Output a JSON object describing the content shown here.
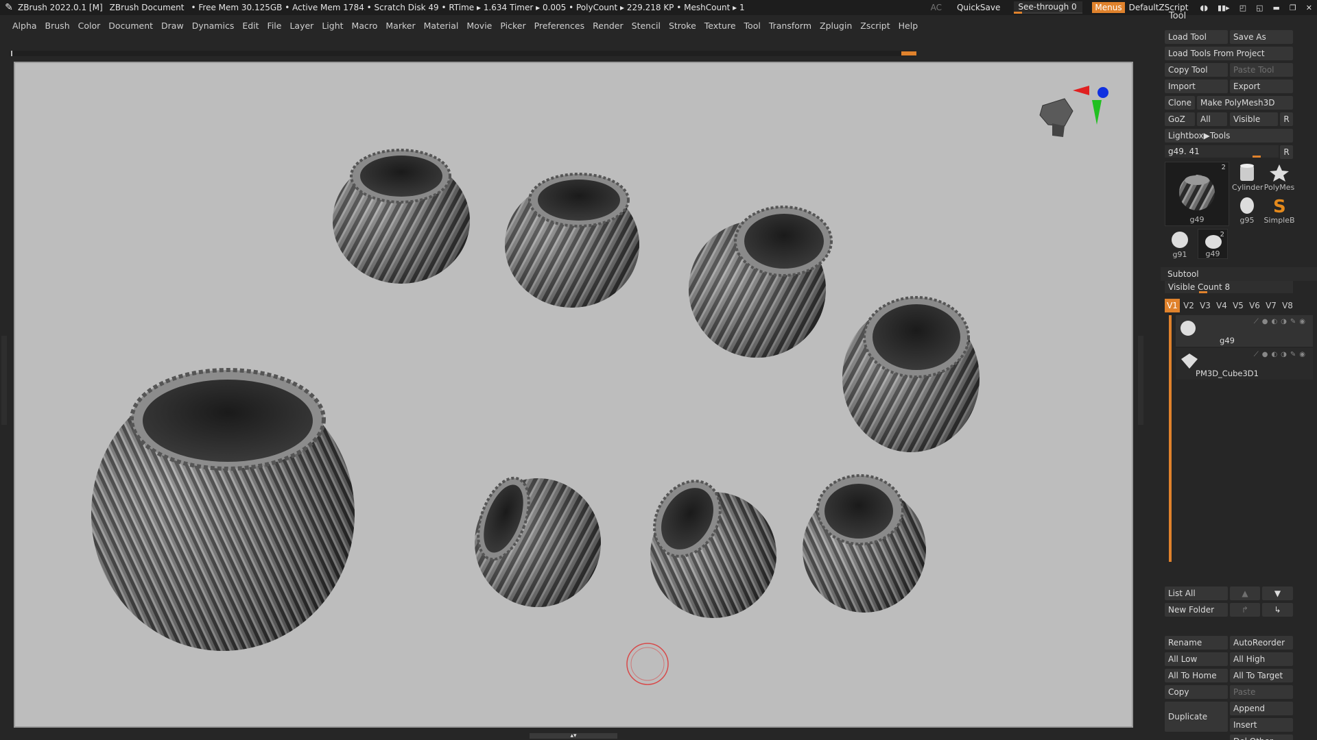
{
  "titlebar": {
    "app_title": "ZBrush 2022.0.1 [M]",
    "document": "ZBrush Document",
    "stats": "• Free Mem 30.125GB • Active Mem 1784 • Scratch Disk 49 • RTime ▸ 1.634 Timer ▸ 0.005 • PolyCount ▸ 229.218 KP • MeshCount ▸ 1",
    "ac": "AC",
    "quicksave": "QuickSave",
    "see_through": "See-through 0",
    "menus": "Menus",
    "default_zscript": "DefaultZScript"
  },
  "menubar": {
    "items": [
      "Alpha",
      "Brush",
      "Color",
      "Document",
      "Draw",
      "Dynamics",
      "Edit",
      "File",
      "Layer",
      "Light",
      "Macro",
      "Marker",
      "Material",
      "Movie",
      "Picker",
      "Preferences",
      "Render",
      "Stencil",
      "Stroke",
      "Texture",
      "Tool",
      "Transform",
      "Zplugin",
      "Zscript",
      "Help"
    ]
  },
  "panel": {
    "title": "Tool",
    "load_tool": "Load Tool",
    "save_as": "Save As",
    "load_from_project": "Load Tools From Project",
    "copy_tool": "Copy Tool",
    "paste_tool": "Paste Tool",
    "import": "Import",
    "export": "Export",
    "clone": "Clone",
    "make_polymesh": "Make PolyMesh3D",
    "goz": "GoZ",
    "all": "All",
    "visible": "Visible",
    "r": "R",
    "lightbox_tools": "Lightbox▶Tools",
    "tool_slider": "g49. 41",
    "thumbs": {
      "main": "g49",
      "main_count": "2",
      "cylinder": "Cylinder",
      "polymesh": "PolyMes",
      "g95": "g95",
      "simpleb": "SimpleB",
      "g91": "g91",
      "g49b": "g49",
      "g49b_count": "2"
    },
    "subtool": {
      "header": "Subtool",
      "visible_count": "Visible Count 8",
      "tabs": [
        "V1",
        "V2",
        "V3",
        "V4",
        "V5",
        "V6",
        "V7",
        "V8"
      ],
      "items": [
        "g49",
        "PM3D_Cube3D1"
      ]
    },
    "list_all": "List All",
    "new_folder": "New Folder",
    "rename": "Rename",
    "autoreorder": "AutoReorder",
    "all_low": "All Low",
    "all_high": "All High",
    "all_to_home": "All To Home",
    "all_to_target": "All To Target",
    "copy": "Copy",
    "paste": "Paste",
    "duplicate": "Duplicate",
    "append": "Append",
    "insert": "Insert",
    "del_other": "Del Other"
  }
}
